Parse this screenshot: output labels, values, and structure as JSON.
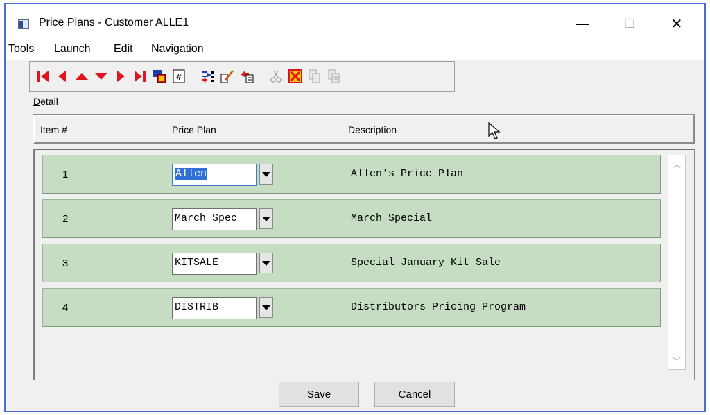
{
  "window": {
    "title": "Price Plans - Customer ALLE1",
    "minimize_glyph": "—",
    "maximize_glyph": "☐",
    "close_glyph": "✕"
  },
  "menu": [
    "Tools",
    "Launch",
    "Edit",
    "Navigation"
  ],
  "toolbar": {
    "buttons": [
      "first-record-icon",
      "previous-record-icon",
      "page-up-icon",
      "page-down-icon",
      "next-record-icon",
      "last-record-icon",
      "find-icon",
      "number-icon",
      "insert-row-icon",
      "edit-icon",
      "paste-icon",
      "cut-icon",
      "delete-icon",
      "copy-icon",
      "duplicate-icon"
    ]
  },
  "detail": {
    "label_underlined": "D",
    "label_rest": "etail",
    "headers": {
      "item": "Item #",
      "plan": "Price Plan",
      "description": "Description"
    }
  },
  "rows": [
    {
      "item": "1",
      "plan": "Allen",
      "description": "Allen's Price Plan"
    },
    {
      "item": "2",
      "plan": "March Spec",
      "description": "March Special"
    },
    {
      "item": "3",
      "plan": "KITSALE",
      "description": "Special January Kit Sale"
    },
    {
      "item": "4",
      "plan": "DISTRIB",
      "description": "Distributors Pricing Program"
    }
  ],
  "scroll": {
    "up": "︿",
    "down": "﹀"
  },
  "buttons": {
    "save": "Save",
    "cancel": "Cancel"
  },
  "colors": {
    "row_bg": "#c6ddc3",
    "window_border": "#4a6fd1",
    "selection": "#2f6fd6"
  }
}
